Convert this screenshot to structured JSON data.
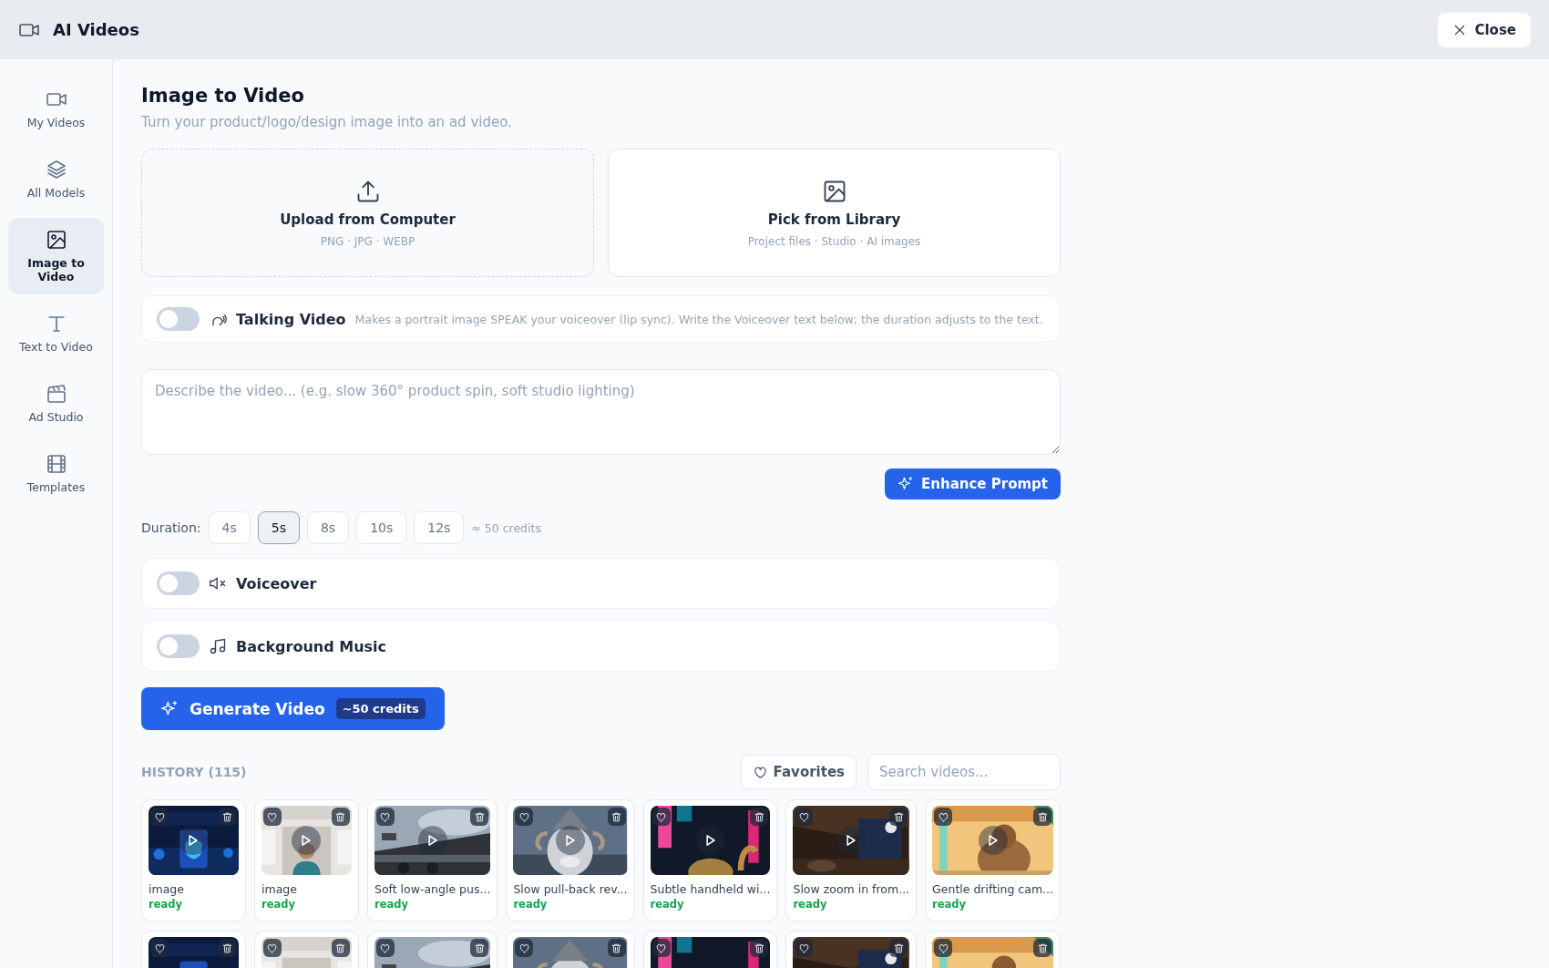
{
  "window": {
    "title": "AI Videos",
    "close": "Close"
  },
  "sidebar": {
    "items": [
      {
        "label": "My Videos",
        "selected": false
      },
      {
        "label": "All Models",
        "selected": false
      },
      {
        "label": "Image to Video",
        "selected": true
      },
      {
        "label": "Text to Video",
        "selected": false
      },
      {
        "label": "Ad Studio",
        "selected": false
      },
      {
        "label": "Templates",
        "selected": false
      }
    ]
  },
  "page": {
    "title": "Image to Video",
    "subtitle": "Turn your product/logo/design image into an ad video."
  },
  "sources": [
    {
      "kind": "upload",
      "title": "Upload from Computer",
      "hint": "PNG · JPG · WEBP"
    },
    {
      "kind": "library",
      "title": "Pick from Library",
      "hint": "Project files · Studio · AI images"
    }
  ],
  "talking": {
    "label": "Talking Video",
    "on": false,
    "note": "Makes a portrait image SPEAK your voiceover (lip sync). Write the Voiceover text below; the duration adjusts to the text."
  },
  "prompt": {
    "placeholder": "Describe the video... (e.g. slow 360° product spin, soft studio lighting)"
  },
  "enhance": "Enhance Prompt",
  "duration": {
    "label": "Duration:",
    "options": [
      {
        "label": "4s",
        "selected": false
      },
      {
        "label": "5s",
        "selected": true
      },
      {
        "label": "8s",
        "selected": false
      },
      {
        "label": "10s",
        "selected": false
      },
      {
        "label": "12s",
        "selected": false
      }
    ],
    "credits": "≈ 50 credits"
  },
  "toggles": [
    {
      "label": "Voiceover",
      "on": false
    },
    {
      "label": "Background Music",
      "on": false
    }
  ],
  "generate": {
    "label": "Generate Video",
    "credits": "~50 credits"
  },
  "history": {
    "title": "HISTORY (115)",
    "favorites": "Favorites",
    "search_placeholder": "Search videos...",
    "cards": [
      {
        "kind": "full",
        "title": "image",
        "status": "ready"
      },
      {
        "kind": "full",
        "title": "image",
        "status": "ready"
      },
      {
        "kind": "full",
        "title": "Soft low-angle pus...",
        "status": "ready"
      },
      {
        "kind": "full",
        "title": "Slow pull-back rev...",
        "status": "ready"
      },
      {
        "kind": "full",
        "title": "Subtle handheld wi...",
        "status": "ready"
      },
      {
        "kind": "full",
        "title": "Slow zoom in from...",
        "status": "ready"
      },
      {
        "kind": "full",
        "title": "Gentle drifting cam...",
        "status": "ready"
      },
      {
        "kind": "cut"
      },
      {
        "kind": "cut"
      },
      {
        "kind": "cut"
      },
      {
        "kind": "cut"
      },
      {
        "kind": "cut"
      },
      {
        "kind": "cut"
      },
      {
        "kind": "cut"
      }
    ]
  }
}
